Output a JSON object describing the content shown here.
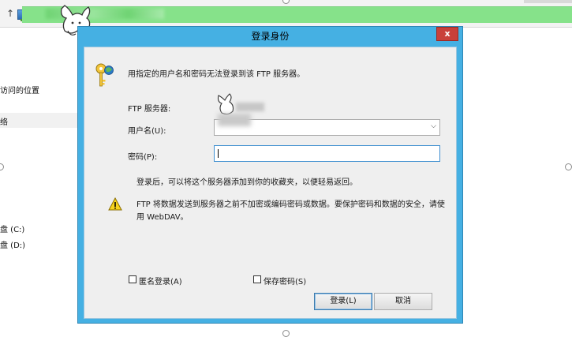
{
  "explorer": {
    "nav_items": [
      "访问的位置",
      "盘 (C:)",
      "盘 (D:)",
      "络"
    ],
    "icons": [
      "up-arrow-icon",
      "computer-icon",
      "chevron-right-icon"
    ]
  },
  "dialog": {
    "title": "登录身份",
    "close_label": "x",
    "intro": "用指定的用户名和密码无法登录到该 FTP 服务器。",
    "server_label": "FTP 服务器:",
    "username_label": "用户名(U):",
    "password_label": "密码(P):",
    "password_value": "",
    "info": "登录后，可以将这个服务器添加到你的收藏夹，以便轻易返回。",
    "warning_line1": "FTP 将数据发送到服务器之前不加密或编码密码或数据。要保护密码和数据的安全，请使",
    "warning_line2": "用 WebDAV。",
    "anonymous_label": "匿名登录(A)",
    "anonymous_checked": false,
    "save_password_label": "保存密码(S)",
    "save_password_checked": false,
    "login_button": "登录(L)",
    "cancel_button": "取消",
    "accent_color": "#45b0e3",
    "close_color": "#c9403a"
  }
}
